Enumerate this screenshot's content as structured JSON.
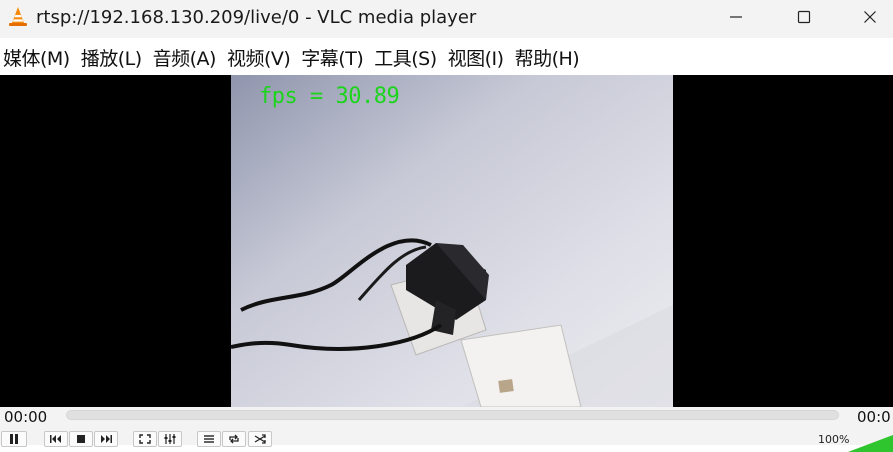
{
  "window": {
    "title": "rtsp://192.168.130.209/live/0 - VLC media player",
    "icon": "vlc-cone-icon",
    "controls": [
      "minimize-icon",
      "maximize-icon",
      "close-icon"
    ]
  },
  "menubar": {
    "items": [
      {
        "label": "媒体(M)"
      },
      {
        "label": "播放(L)"
      },
      {
        "label": "音频(A)"
      },
      {
        "label": "视频(V)"
      },
      {
        "label": "字幕(T)"
      },
      {
        "label": "工具(S)"
      },
      {
        "label": "视图(I)"
      },
      {
        "label": "帮助(H)"
      }
    ]
  },
  "video": {
    "overlay_text": "fps = 30.89",
    "overlay_color": "#1cd41c"
  },
  "playback": {
    "time_elapsed": "00:00",
    "time_total": "00:0",
    "volume_label": "100%",
    "volume_level": 1.0,
    "buttons": [
      "pause-icon",
      "previous-icon",
      "stop-icon",
      "next-icon",
      "fullscreen-icon",
      "extended-settings-icon",
      "playlist-icon",
      "loop-icon",
      "shuffle-icon"
    ]
  },
  "colors": {
    "accent": "#1cd41c",
    "chrome": "#f3f3f3",
    "video_bg": "#000000"
  }
}
